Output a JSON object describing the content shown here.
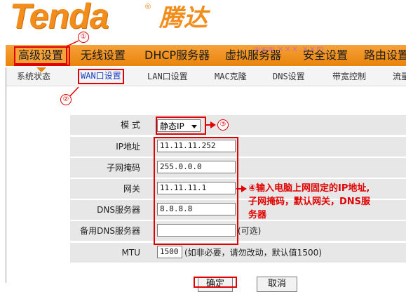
{
  "header": {
    "logo_en": "Tenda",
    "logo_reg": "®",
    "logo_cn": "腾达"
  },
  "nav": {
    "items": [
      {
        "label": "高级设置"
      },
      {
        "label": "无线设置"
      },
      {
        "label": "DHCP服务器"
      },
      {
        "label": "虚拟服务器"
      },
      {
        "label": "安全设置"
      },
      {
        "label": "路由设置"
      }
    ],
    "watermark": "www.×××.××m"
  },
  "subnav": {
    "items": [
      {
        "label": "系统状态"
      },
      {
        "label": "WAN口设置"
      },
      {
        "label": "LAN口设置"
      },
      {
        "label": "MAC克隆"
      },
      {
        "label": "DNS设置"
      },
      {
        "label": "带宽控制"
      },
      {
        "label": "流量"
      }
    ]
  },
  "form": {
    "mode_label": "模  式",
    "mode_value": "静态IP",
    "ip_label": "IP地址",
    "ip_value": "11.11.11.252",
    "mask_label": "子网掩码",
    "mask_value": "255.0.0.0",
    "gateway_label": "网关",
    "gateway_value": "11.11.11.1",
    "dns_label": "DNS服务器",
    "dns_value": "8.8.8.8",
    "dns2_label": "备用DNS服务器",
    "dns2_value": "",
    "dns2_hint": "(可选)",
    "mtu_label": "MTU",
    "mtu_value": "1500",
    "mtu_hint": "(如非必要，请勿改动，默认值1500)"
  },
  "buttons": {
    "ok_label": "确定",
    "cancel_label": "取消"
  },
  "annotations": {
    "n1": "①",
    "n2": "②",
    "n3": "③",
    "n4_line1": "④输入电脑上网固定的IP地址,",
    "n4_line2": "子网掩码，默认网关，DNS服",
    "n4_line3": "务器"
  }
}
